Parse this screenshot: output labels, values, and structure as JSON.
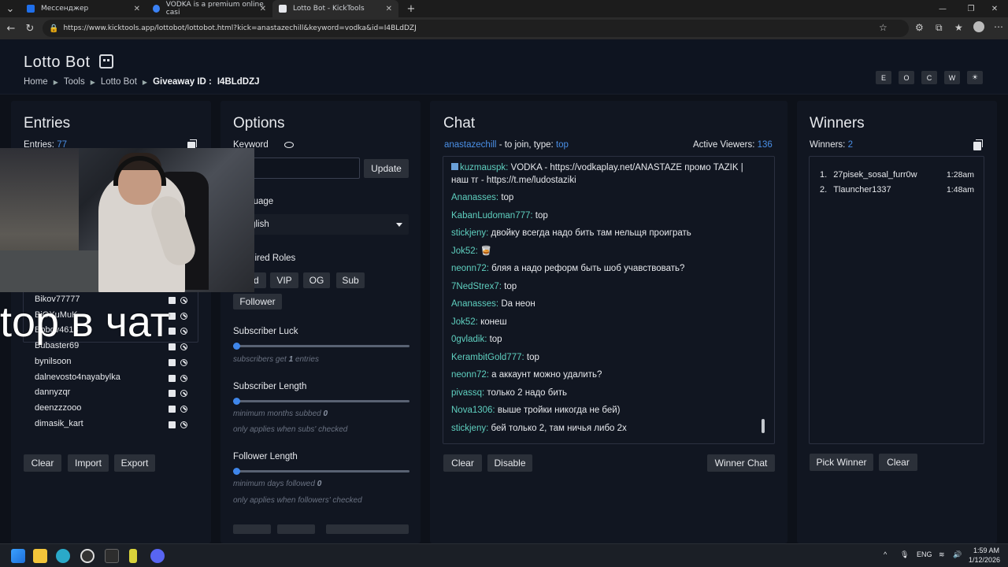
{
  "browser": {
    "tabs": [
      {
        "label": "Мессенджер",
        "color": "#1f6feb"
      },
      {
        "label": "VODKA is a premium online casi",
        "color": "#3b82f6"
      },
      {
        "label": "Lotto Bot - KickTools",
        "color": "#e6e8ec"
      }
    ],
    "url": "https://www.kicktools.app/lottobot/lottobot.html?kick=anastazechill&keyword=vodka&id=I4BLdDZJ"
  },
  "header": {
    "title": "Lotto Bot",
    "breadcrumb": [
      "Home",
      "Tools",
      "Lotto Bot"
    ],
    "giveaway_label": "Giveaway ID :",
    "giveaway_id": "I4BLdDZJ",
    "buttons": [
      "E",
      "O",
      "C",
      "W",
      "☀"
    ]
  },
  "entries": {
    "title": "Entries",
    "count_label": "Entries:",
    "count": "77",
    "list": [
      "Bikov77777",
      "BiOXuMuK",
      "Bobov4613",
      "Bubaster69",
      "bynilsoon",
      "dalnevosto4nayabylka",
      "dannyzqr",
      "deenzzzooo",
      "dimasik_kart"
    ],
    "clear": "Clear",
    "import": "Import",
    "export": "Export"
  },
  "overlay_text": "top в чат",
  "options": {
    "title": "Options",
    "keyword_label": "Keyword",
    "update": "Update",
    "language_label": "Language",
    "language_value": "English",
    "roles_label": "Required Roles",
    "roles": [
      "Mod",
      "VIP",
      "OG",
      "Sub",
      "Follower"
    ],
    "sub_luck_label": "Subscriber Luck",
    "sub_luck_hint_pre": "subscribers get",
    "sub_luck_value": "1",
    "sub_luck_hint_post": "entries",
    "sub_length_label": "Subscriber Length",
    "sub_length_hint_pre": "minimum months subbed",
    "sub_length_value": "0",
    "sub_length_note": "only applies when subs' checked",
    "follower_length_label": "Follower Length",
    "follower_length_hint_pre": "minimum days followed",
    "follower_length_value": "0",
    "follower_length_note": "only applies when followers' checked",
    "sliders": {
      "sub_luck": 0,
      "sub_length": 0,
      "follower_length": 0
    }
  },
  "chat": {
    "title": "Chat",
    "channel": "anastazechill",
    "join_text": "- to join, type:",
    "keyword": "top",
    "viewers_label": "Active Viewers:",
    "viewers": "136",
    "messages": [
      {
        "nick": "kuzmauspk:",
        "text": "VODKA - https://vodkaplay.net/ANASTAZE промо TAZIK | наш тг - https://t.me/ludostaziki"
      },
      {
        "nick": "Ananasses:",
        "text": "top"
      },
      {
        "nick": "KabanLudoman777:",
        "text": "top"
      },
      {
        "nick": "stickjeny:",
        "text": "двойку всегда надо бить там нельщя проиграть"
      },
      {
        "nick": "Jok52:",
        "text": "🥃"
      },
      {
        "nick": "neonn72:",
        "text": "бляя а надо реформ быть шоб учавствовать?"
      },
      {
        "nick": "7NedStrex7:",
        "text": "top"
      },
      {
        "nick": "Ananasses:",
        "text": "Da неон"
      },
      {
        "nick": "Jok52:",
        "text": "конеш"
      },
      {
        "nick": "0gvladik:",
        "text": "top"
      },
      {
        "nick": "KerambitGold777:",
        "text": "top"
      },
      {
        "nick": "neonn72:",
        "text": "а аккаунт можно удалить?"
      },
      {
        "nick": "pivassq:",
        "text": "только 2 надо бить"
      },
      {
        "nick": "Nova1306:",
        "text": "выше тройки никогда не бей)"
      },
      {
        "nick": "stickjeny:",
        "text": "бей только 2, там ничья либо 2х"
      }
    ],
    "clear": "Clear",
    "disable": "Disable",
    "winner_chat": "Winner Chat"
  },
  "winners": {
    "title": "Winners",
    "count_label": "Winners:",
    "count": "2",
    "list": [
      {
        "num": "1.",
        "name": "27pisek_sosal_furr0w",
        "time": "1:28am"
      },
      {
        "num": "2.",
        "name": "Tlauncher1337",
        "time": "1:48am"
      }
    ],
    "pick": "Pick Winner",
    "clear": "Clear"
  },
  "taskbar": {
    "lang": "ENG",
    "time": "1:59 AM",
    "date": "1/12/2026"
  },
  "colors": {
    "accent": "#4a8fe6",
    "nick": "#5fd0c0",
    "slider": "#3f86ea"
  }
}
